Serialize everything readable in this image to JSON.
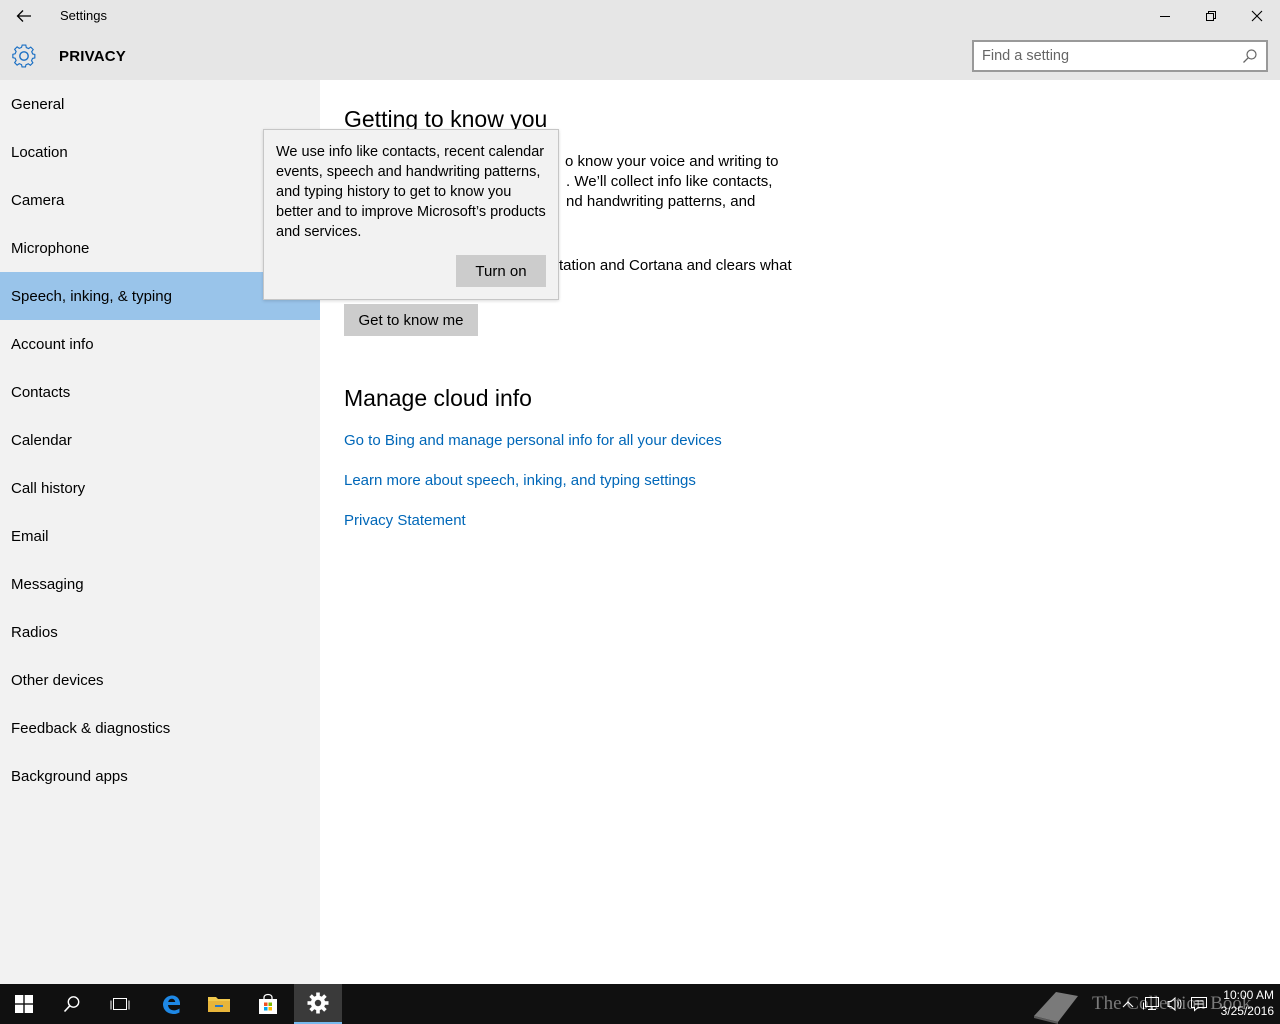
{
  "window": {
    "title": "Settings"
  },
  "header": {
    "section": "PRIVACY",
    "search_placeholder": "Find a setting"
  },
  "sidebar": {
    "items": [
      {
        "label": "General"
      },
      {
        "label": "Location"
      },
      {
        "label": "Camera"
      },
      {
        "label": "Microphone"
      },
      {
        "label": "Speech, inking, & typing",
        "active": true
      },
      {
        "label": "Account info"
      },
      {
        "label": "Contacts"
      },
      {
        "label": "Calendar"
      },
      {
        "label": "Call history"
      },
      {
        "label": "Email"
      },
      {
        "label": "Messaging"
      },
      {
        "label": "Radios"
      },
      {
        "label": "Other devices"
      },
      {
        "label": "Feedback & diagnostics"
      },
      {
        "label": "Background apps"
      }
    ]
  },
  "main": {
    "getting_to_know_heading": "Getting to know you",
    "para1_line1": "o know your voice and writing to",
    "para1_line2": ". We’ll collect info like contacts,",
    "para1_line3": "nd handwriting patterns, and",
    "para2_line1": "tation and Cortana and clears what",
    "get_to_know_button": "Get to know me",
    "manage_heading": "Manage cloud info",
    "links": [
      "Go to Bing and manage personal info for all your devices",
      "Learn more about speech, inking, and typing settings",
      "Privacy Statement"
    ]
  },
  "popup": {
    "text": "We use info like contacts, recent calendar events, speech and handwriting patterns, and typing history to get to know you better and to improve Microsoft’s products and services.",
    "button": "Turn on"
  },
  "taskbar": {
    "watermark": "The Collection Book",
    "time": "10:00 AM",
    "date": "3/25/2016"
  },
  "colors": {
    "accent": "#0067b8",
    "selected_nav": "#99c4ea",
    "chrome": "#e6e6e6",
    "taskbar": "#101010"
  },
  "icons": [
    "back-arrow-icon",
    "minimize-icon",
    "maximize-icon",
    "close-icon",
    "gear-icon",
    "search-icon",
    "windows-start-icon",
    "cortana-search-icon",
    "task-view-icon",
    "edge-icon",
    "file-explorer-icon",
    "store-icon",
    "settings-icon",
    "book-icon",
    "chevron-up-icon",
    "network-icon",
    "volume-icon",
    "action-center-icon"
  ]
}
